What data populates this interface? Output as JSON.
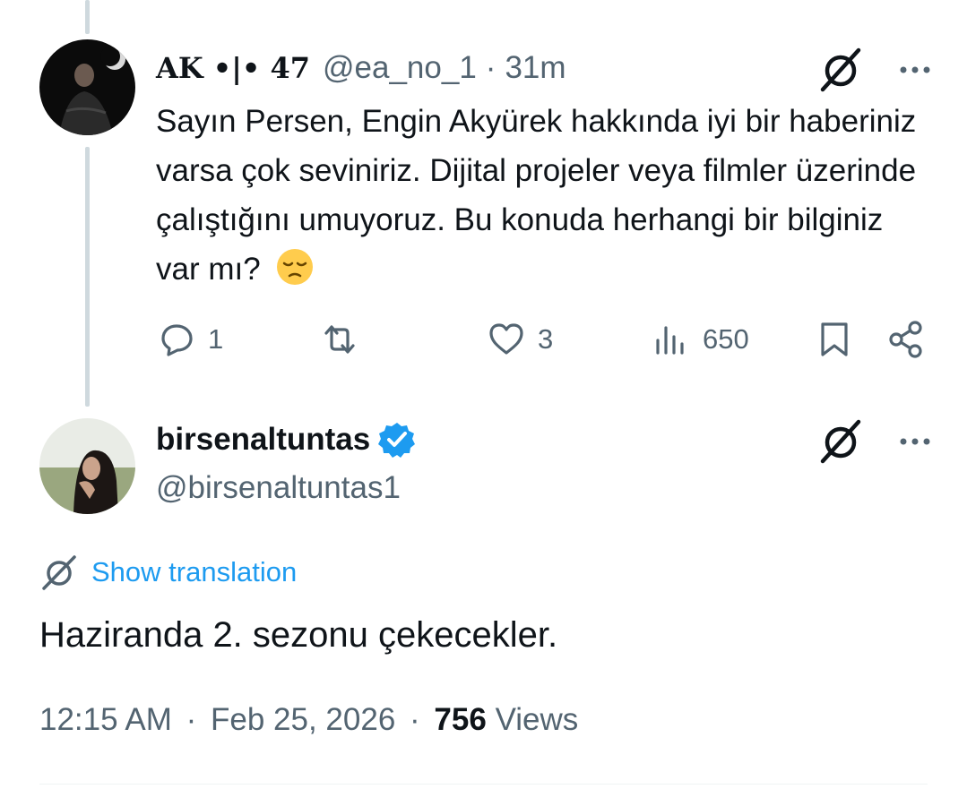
{
  "reply": {
    "display_name": "AK •|• 47",
    "handle": "@ea_no_1",
    "separator": "·",
    "time_ago": "31m",
    "text": "Sayın Persen, Engin Akyürek hakkında iyi bir haberiniz varsa çok seviniriz. Dijital projeler veya filmler üzerinde çalıştığını umuyoruz. Bu konuda herhangi bir bilginiz var mı?",
    "emoji": "pensive-face",
    "reply_count": "1",
    "like_count": "3",
    "view_count": "650"
  },
  "main": {
    "display_name": "birsenaltuntas",
    "handle": "@birsenaltuntas1",
    "translation_label": "Show translation",
    "text": "Haziranda 2. sezonu çekecekler.",
    "time": "12:15 AM",
    "separator": "·",
    "date": "Feb 25, 2026",
    "views_count": "756",
    "views_label": "Views"
  },
  "colors": {
    "text": "#0f1419",
    "muted": "#536471",
    "accent": "#1d9bf0",
    "thread_line": "#cfd9de"
  },
  "icons": [
    "grok-icon",
    "more-icon",
    "reply-icon",
    "retweet-icon",
    "like-icon",
    "views-icon",
    "bookmark-icon",
    "share-icon",
    "verified-badge-icon",
    "translate-icon"
  ]
}
